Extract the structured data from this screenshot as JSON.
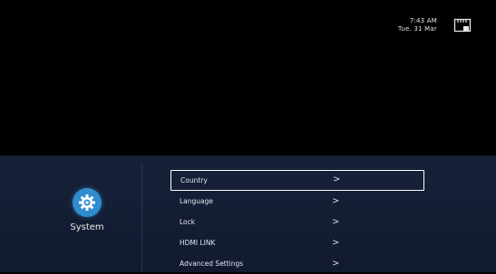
{
  "status": {
    "time": "7:43 AM",
    "date": "Tue. 31 Mar",
    "network_icon": "ethernet-icon"
  },
  "category": {
    "label": "System",
    "icon": "gear-icon",
    "accent": "#2f8ccf"
  },
  "menu": {
    "items": [
      {
        "label": "Country",
        "selected": true
      },
      {
        "label": "Language",
        "selected": false
      },
      {
        "label": "Lock",
        "selected": false
      },
      {
        "label": "HDMI LINK",
        "selected": false
      },
      {
        "label": "Advanced Settings",
        "selected": false
      }
    ],
    "chevron": ">"
  }
}
